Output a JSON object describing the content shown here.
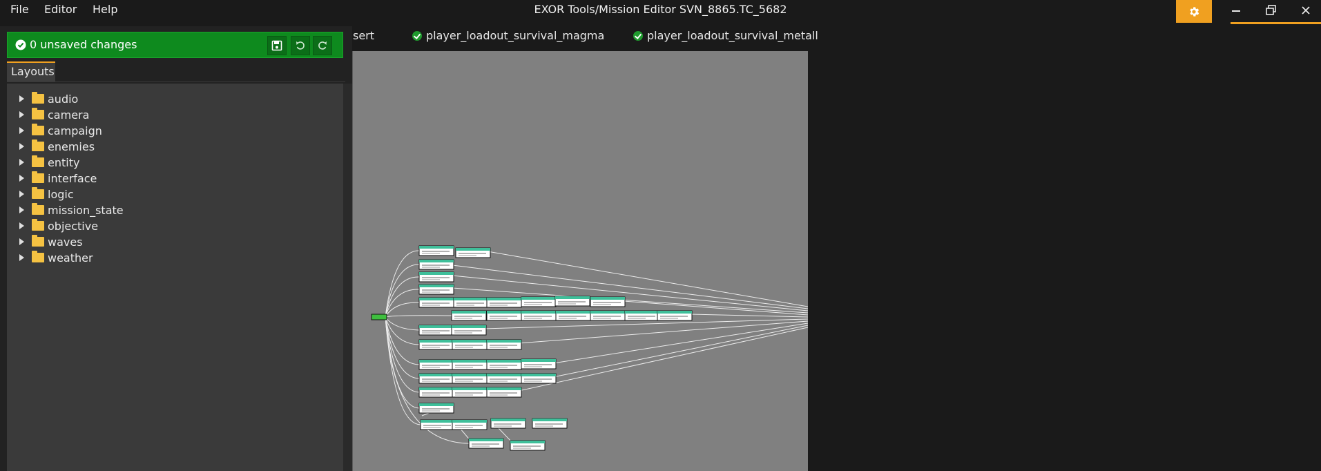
{
  "menu": {
    "file": "File",
    "editor": "Editor",
    "help": "Help"
  },
  "window": {
    "title": "EXOR Tools/Mission Editor SVN_8865.TC_5682"
  },
  "status": {
    "text": "0 unsaved changes"
  },
  "panel": {
    "tab_label": "Layouts",
    "folders": [
      "audio",
      "camera",
      "campaign",
      "enemies",
      "entity",
      "interface",
      "logic",
      "mission_state",
      "objective",
      "waves",
      "weather"
    ]
  },
  "tabs": [
    {
      "label": "sert",
      "saved": false
    },
    {
      "label": "player_loadout_survival_magma",
      "saved": true
    },
    {
      "label": "player_loadout_survival_metall",
      "saved": true
    }
  ],
  "colors": {
    "accent": "#f0a020",
    "status_green": "#0e8a1e",
    "canvas_bg": "#808080",
    "node_header": "#3fbf9a",
    "folder": "#f5c242"
  },
  "icons": {
    "settings": "gear-icon",
    "save": "save-icon",
    "undo": "undo-icon",
    "redo": "redo-icon",
    "status": "check-circle-icon"
  }
}
